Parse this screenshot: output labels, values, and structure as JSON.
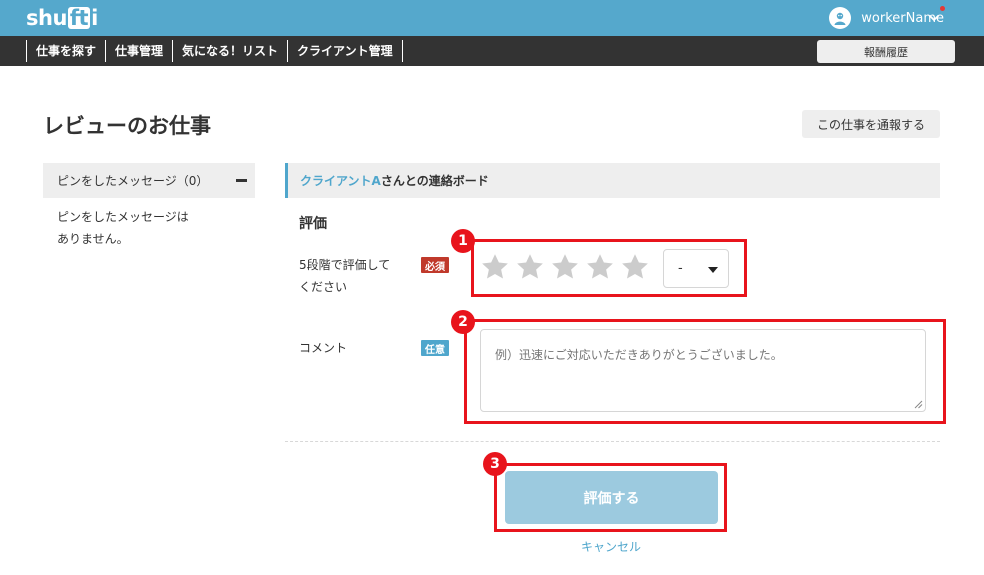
{
  "header": {
    "logo_left": "shu",
    "logo_box": "ft",
    "logo_right": "i",
    "user_name": "workerName",
    "colors": {
      "bar": "#55a8cc",
      "notification": "#e53935"
    },
    "icons": {
      "avatar": "avatar-icon",
      "menu": "chevron-down-icon"
    }
  },
  "nav": {
    "items": [
      "仕事を探す",
      "仕事管理",
      "気になる！リスト",
      "クライアント管理"
    ],
    "reward_button": "報酬履歴"
  },
  "page": {
    "title": "レビューのお仕事",
    "report_button": "この仕事を通報する"
  },
  "sidebar": {
    "pinned_header": "ピンをしたメッセージ（0）",
    "pinned_empty_line1": "ピンをしたメッセージは",
    "pinned_empty_line2": "ありません。"
  },
  "board": {
    "client_name": "クライアントA",
    "title_suffix": "さんとの連絡ボード"
  },
  "review": {
    "section_title": "評価",
    "rating_label_line1": "5段階で評価して",
    "rating_label_line2": "ください",
    "required_badge": "必須",
    "star_count": 5,
    "rating_value": 0,
    "rating_select_value": "-",
    "comment_label": "コメント",
    "optional_badge": "任意",
    "comment_placeholder": "例）迅速にご対応いただきありがとうございました。",
    "submit_button": "評価する",
    "cancel_link": "キャンセル"
  },
  "annotations": [
    "1",
    "2",
    "3"
  ],
  "colors": {
    "accent": "#4fa6cc",
    "required": "#c0392b",
    "annotation": "#e8141c",
    "submit_disabled": "#9ccadf"
  }
}
